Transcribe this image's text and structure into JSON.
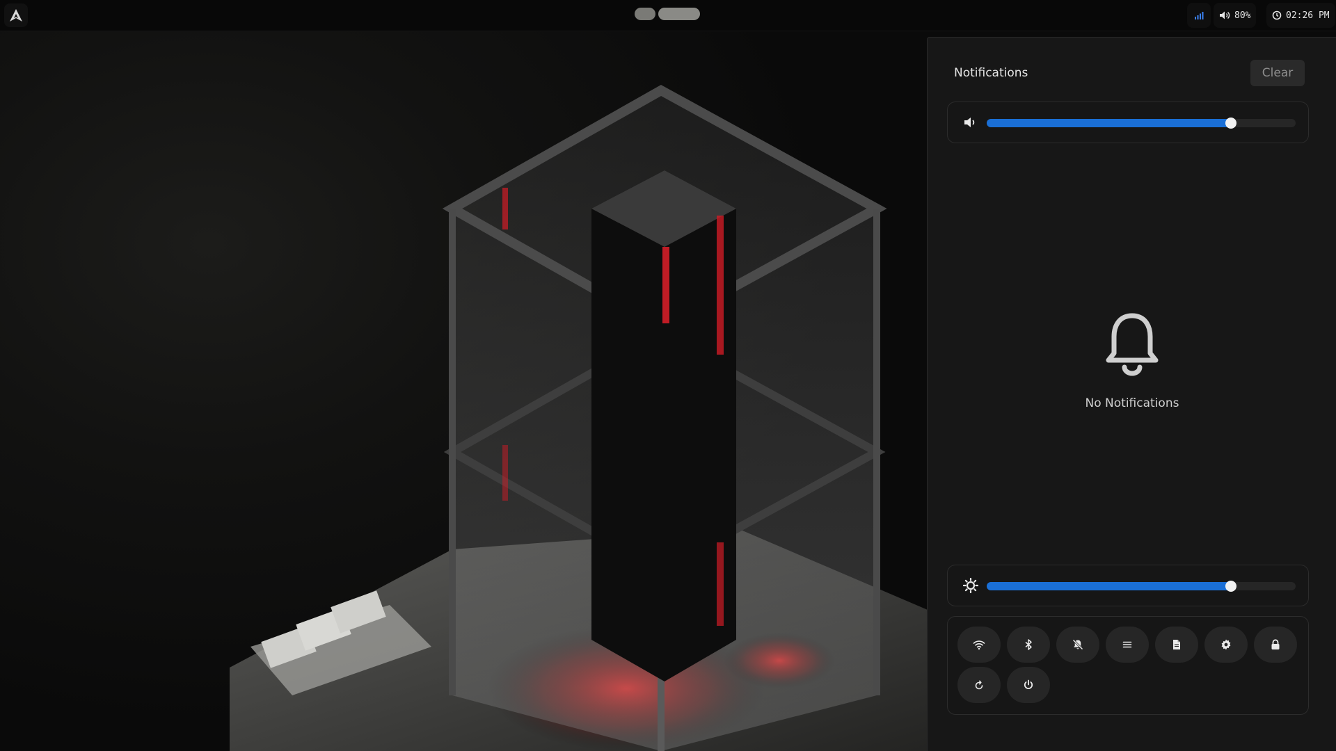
{
  "topbar": {
    "logo_icon": "arch-logo-icon",
    "workspaces": [
      "workspace-1",
      "workspace-2"
    ],
    "volume_label": "80%",
    "clock": "02:26 PM"
  },
  "notifications": {
    "title": "Notifications",
    "clear_label": "Clear",
    "empty_text": "No Notifications",
    "volume_level": 0.79,
    "brightness_level": 0.79
  },
  "quick_actions": [
    {
      "name": "wifi-toggle-button",
      "icon": "wifi-icon"
    },
    {
      "name": "bluetooth-toggle-button",
      "icon": "bluetooth-icon"
    },
    {
      "name": "do-not-disturb-button",
      "icon": "bell-off-icon"
    },
    {
      "name": "menu-button",
      "icon": "menu-icon"
    },
    {
      "name": "notes-button",
      "icon": "file-icon"
    },
    {
      "name": "settings-button",
      "icon": "gear-icon"
    },
    {
      "name": "lock-button",
      "icon": "lock-icon"
    },
    {
      "name": "restart-button",
      "icon": "restart-icon"
    },
    {
      "name": "power-button",
      "icon": "power-icon"
    }
  ],
  "colors": {
    "accent": "#1a6fd6",
    "panel_bg": "#171717",
    "wallpaper_glow": "#e01e2a"
  }
}
